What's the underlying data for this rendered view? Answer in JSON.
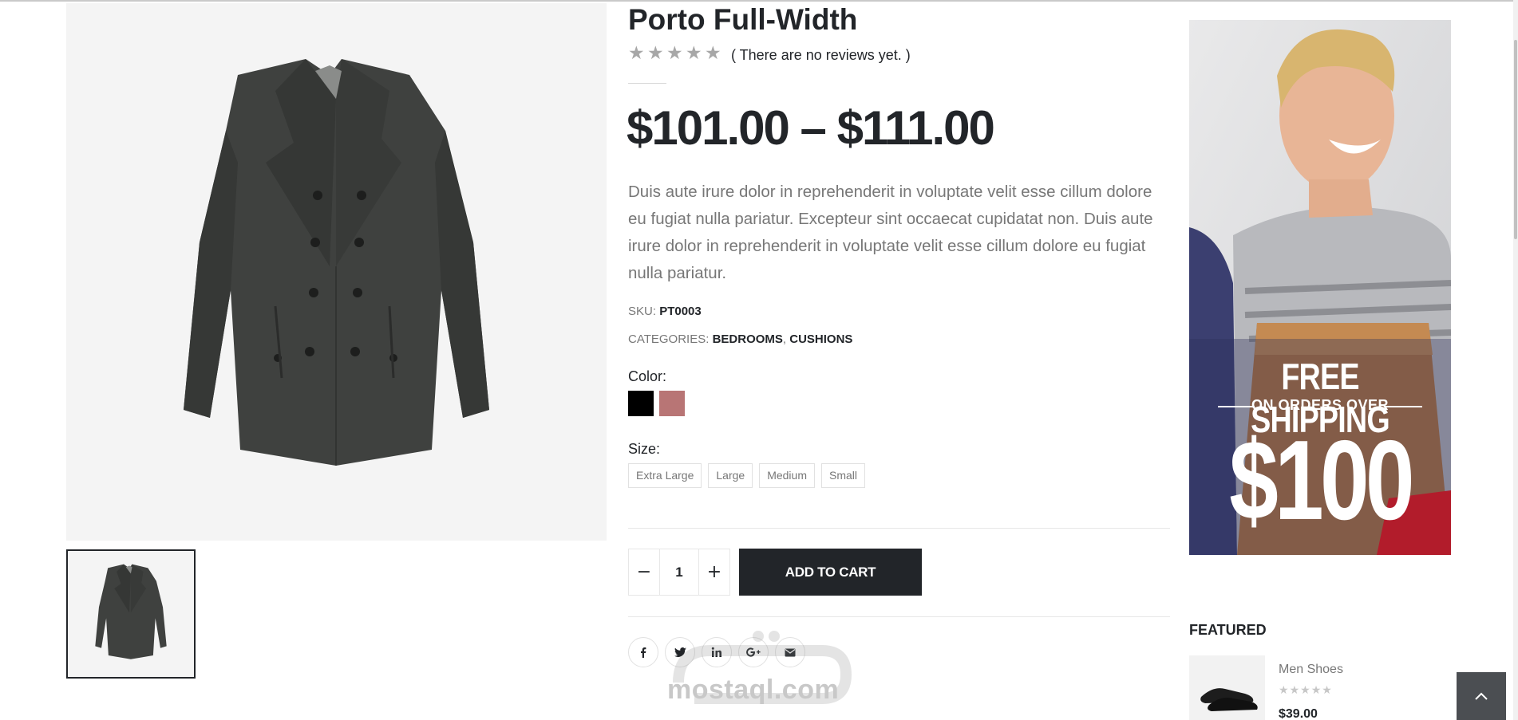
{
  "product": {
    "title": "Porto Full-Width",
    "rating_stars": 0,
    "reviews_text": "( There are no reviews yet. )",
    "price": "$101.00 – $111.00",
    "description": "Duis aute irure dolor in reprehenderit in voluptate velit esse cillum dolore eu fugiat nulla pariatur. Excepteur sint occaecat cupidatat non. Duis aute irure dolor in reprehenderit in voluptate velit esse cillum dolore eu fugiat nulla pariatur.",
    "sku_label": "SKU:",
    "sku_value": "PT0003",
    "categories_label": "CATEGORIES:",
    "categories": [
      "BEDROOMS",
      "CUSHIONS"
    ],
    "category_separator": ",",
    "color_label": "Color:",
    "colors": [
      "#000000",
      "#b87575"
    ],
    "size_label": "Size:",
    "sizes": [
      "Extra Large",
      "Large",
      "Medium",
      "Small"
    ],
    "quantity": "1",
    "minus_symbol": "−",
    "plus_symbol": "+",
    "add_to_cart_label": "ADD TO CART",
    "share_icons": [
      "facebook-icon",
      "twitter-icon",
      "linkedin-icon",
      "google-plus-icon",
      "email-icon"
    ]
  },
  "watermark": {
    "text": "mostaql.com"
  },
  "sidebar": {
    "banner": {
      "line1": "FREE SHIPPING",
      "line2": "ON ORDERS OVER",
      "line3": "$100"
    },
    "featured_title": "FEATURED",
    "featured_items": [
      {
        "name": "Men Shoes",
        "price": "$39.00",
        "rating_stars": 0
      }
    ]
  },
  "colors": {
    "primary_dark": "#222529",
    "text_muted": "#777777",
    "swatch_pink": "#b87575"
  }
}
